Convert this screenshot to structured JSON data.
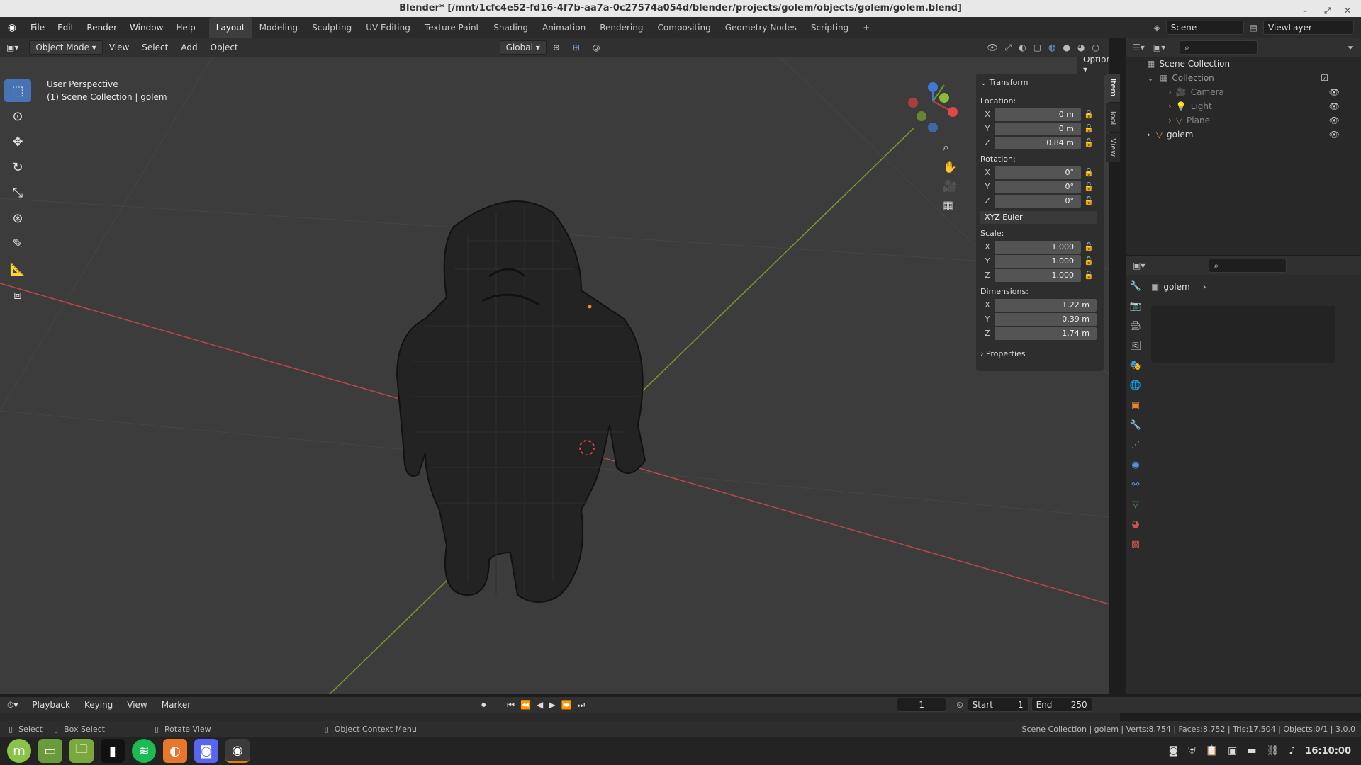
{
  "window": {
    "title": "Blender* [/mnt/1cfc4e52-fd16-4f7b-aa7a-0c27574a054d/blender/projects/golem/objects/golem/golem.blend]"
  },
  "menu": [
    "File",
    "Edit",
    "Render",
    "Window",
    "Help"
  ],
  "workspaces": [
    "Layout",
    "Modeling",
    "Sculpting",
    "UV Editing",
    "Texture Paint",
    "Shading",
    "Animation",
    "Rendering",
    "Compositing",
    "Geometry Nodes",
    "Scripting"
  ],
  "active_workspace": "Layout",
  "scene": {
    "name": "Scene",
    "view_layer": "ViewLayer"
  },
  "viewport_header": {
    "mode": "Object Mode",
    "menus": [
      "View",
      "Select",
      "Add",
      "Object"
    ],
    "orientation": "Global",
    "options": "Options"
  },
  "viewport": {
    "perspective": "User Perspective",
    "context": "(1) Scene Collection | golem"
  },
  "npanel": {
    "tabs": [
      "Item",
      "Tool",
      "View"
    ],
    "section": "Transform",
    "location_label": "Location:",
    "location": {
      "x": "0 m",
      "y": "0 m",
      "z": "0.84 m"
    },
    "rotation_label": "Rotation:",
    "rotation": {
      "x": "0°",
      "y": "0°",
      "z": "0°"
    },
    "rotation_mode": "XYZ Euler",
    "scale_label": "Scale:",
    "scale": {
      "x": "1.000",
      "y": "1.000",
      "z": "1.000"
    },
    "dimensions_label": "Dimensions:",
    "dimensions": {
      "x": "1.22 m",
      "y": "0.39 m",
      "z": "1.74 m"
    },
    "properties": "Properties",
    "axis": {
      "x": "X",
      "y": "Y",
      "z": "Z"
    }
  },
  "outliner": {
    "root": "Scene Collection",
    "collection": "Collection",
    "items": [
      "Camera",
      "Light",
      "Plane"
    ],
    "object": "golem"
  },
  "properties_panel": {
    "object": "golem"
  },
  "timeline": {
    "menus": [
      "Playback",
      "Keying",
      "View",
      "Marker"
    ],
    "current_frame": "1",
    "start_label": "Start",
    "start": "1",
    "end_label": "End",
    "end": "250"
  },
  "status": {
    "select": "Select",
    "box_select": "Box Select",
    "rotate": "Rotate View",
    "context_menu": "Object Context Menu",
    "info": "Scene Collection | golem | Verts:8,754 | Faces:8,752 | Tris:17,504 | Objects:0/1 | 3.0.0"
  },
  "clock": "16:10:00",
  "colors": {
    "accent": "#4772b3",
    "x_axis": "#c63d3d",
    "y_axis": "#6b9a2d",
    "z_axis": "#3e79d3",
    "viewport_bg": "#3c3c3c"
  }
}
